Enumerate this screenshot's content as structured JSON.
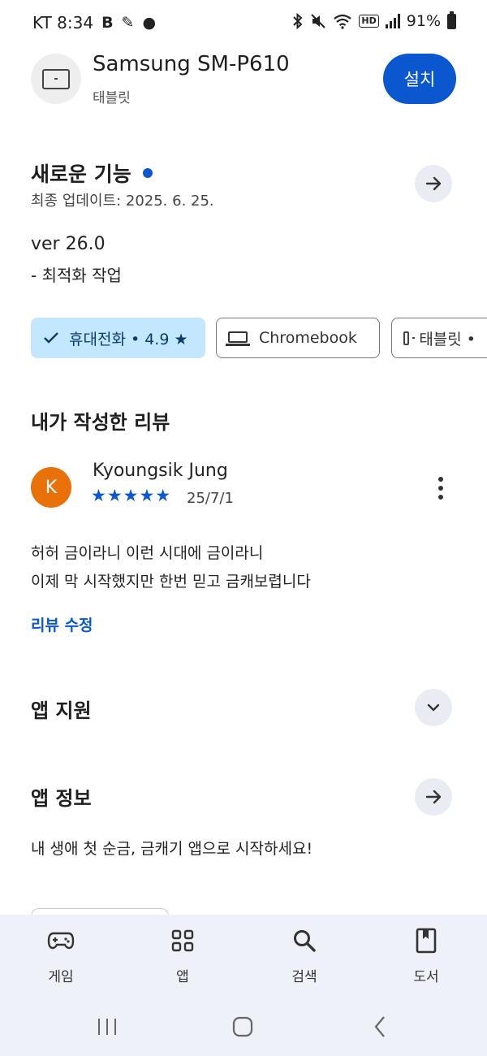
{
  "status_bar": {
    "carrier_time": "KT 8:34",
    "glyphs": [
      "B",
      "✎",
      "●"
    ],
    "hd_badge": "HD",
    "battery": "91%"
  },
  "header": {
    "device_name": "Samsung SM-P610",
    "device_type": "태블릿",
    "install_label": "설치",
    "icon": "tablet-icon"
  },
  "whats_new": {
    "title": "새로운 기능",
    "updated": "최종 업데이트: 2025. 6. 25.",
    "version": "ver 26.0",
    "note": "- 최적화 작업"
  },
  "device_chips": [
    {
      "label": "휴대전화 • 4.9 ★",
      "icon": "check-icon",
      "selected": true
    },
    {
      "label": "Chromebook",
      "icon": "laptop-icon",
      "selected": false
    },
    {
      "label": "태블릿 •",
      "icon": "tablet-icon",
      "selected": false
    }
  ],
  "my_review": {
    "title": "내가 작성한 리뷰",
    "avatar_letter": "K",
    "reviewer": "Kyoungsik Jung",
    "stars": "★★★★★",
    "rating": 5,
    "date": "25/7/1",
    "text_line1": "허허 금이라니 이런 시대에 금이라니",
    "text_line2": "이제 막 시작했지만 한번 믿고 금캐보렵니다",
    "edit_label": "리뷰 수정"
  },
  "app_support": {
    "title": "앱 지원"
  },
  "app_info": {
    "title": "앱 정보",
    "description": "내 생애 첫 순금, 금캐기 앱으로 시작하세요!"
  },
  "bottom_nav": [
    {
      "label": "게임",
      "icon": "gamepad-icon"
    },
    {
      "label": "앱",
      "icon": "apps-grid-icon"
    },
    {
      "label": "검색",
      "icon": "search-icon"
    },
    {
      "label": "도서",
      "icon": "book-icon"
    }
  ],
  "colors": {
    "accent": "#0b57d0",
    "chip_selected": "#c2e7ff",
    "avatar": "#e8710a",
    "nav_background": "#eef1f8"
  }
}
